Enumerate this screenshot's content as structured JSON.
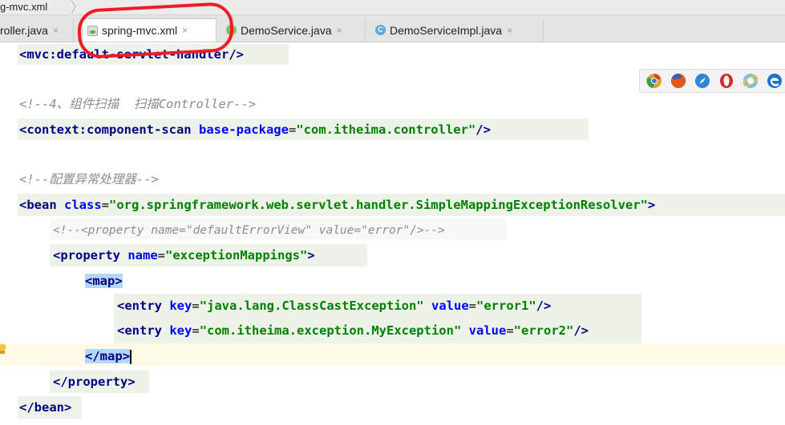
{
  "breadcrumb": {
    "label": "g-mvc.xml"
  },
  "tabs": [
    {
      "label": "roller.java",
      "icon": "java-class-icon"
    },
    {
      "label": "spring-mvc.xml",
      "icon": "xml-file-icon",
      "active": true
    },
    {
      "label": "DemoService.java",
      "icon": "java-interface-icon",
      "icon_letter": "I"
    },
    {
      "label": "DemoServiceImpl.java",
      "icon": "java-class-icon",
      "icon_letter": "C"
    }
  ],
  "close_glyph": "×",
  "editor": {
    "l1": {
      "a": "<",
      "b": "mvc:default-servlet-handler",
      "c": "/>"
    },
    "l2": {
      "comment": "<!--4、组件扫描  扫描Controller-->"
    },
    "l3": {
      "a": "<",
      "tag": "context:component-scan",
      "attr": " base-package",
      "eq": "=",
      "val": "\"com.itheima.controller\"",
      "end": "/>"
    },
    "l4": {
      "comment": "<!--配置异常处理器-->"
    },
    "l5": {
      "a": "<",
      "tag": "bean",
      "attr": " class",
      "eq": "=",
      "val": "\"org.springframework.web.servlet.handler.SimpleMappingExceptionResolver\"",
      "end": ">"
    },
    "l6": {
      "comment": "<!--<property name=\"defaultErrorView\" value=\"error\"/>-->"
    },
    "l7": {
      "a": "<",
      "tag": "property",
      "attr": " name",
      "eq": "=",
      "val": "\"exceptionMappings\"",
      "end": ">"
    },
    "l8": {
      "a": "<",
      "tag": "map",
      "end": ">"
    },
    "l9": {
      "a": "<",
      "tag": "entry",
      "attr1": " key",
      "eq1": "=",
      "val1": "\"java.lang.ClassCastException\"",
      "attr2": " value",
      "eq2": "=",
      "val2": "\"error1\"",
      "end": "/>"
    },
    "l10": {
      "a": "<",
      "tag": "entry",
      "attr1": " key",
      "eq1": "=",
      "val1": "\"com.itheima.exception.MyException\"",
      "attr2": " value",
      "eq2": "=",
      "val2": "\"error2\"",
      "end": "/>"
    },
    "l11": {
      "a": "</",
      "tag": "map",
      "end": ">"
    },
    "l12": {
      "a": "</",
      "tag": "property",
      "end": ">"
    },
    "l13": {
      "a": "</",
      "tag": "bean",
      "end": ">"
    }
  },
  "browser_icons": [
    {
      "name": "chrome-icon",
      "color": "#e0a22a"
    },
    {
      "name": "firefox-icon",
      "color": "#e2571e"
    },
    {
      "name": "safari-icon",
      "color": "#2f86d6"
    },
    {
      "name": "opera-icon",
      "color": "#d42a2a"
    },
    {
      "name": "internet-explorer-icon",
      "color": "#6ec3e8"
    },
    {
      "name": "edge-icon",
      "color": "#1f74c9"
    }
  ]
}
